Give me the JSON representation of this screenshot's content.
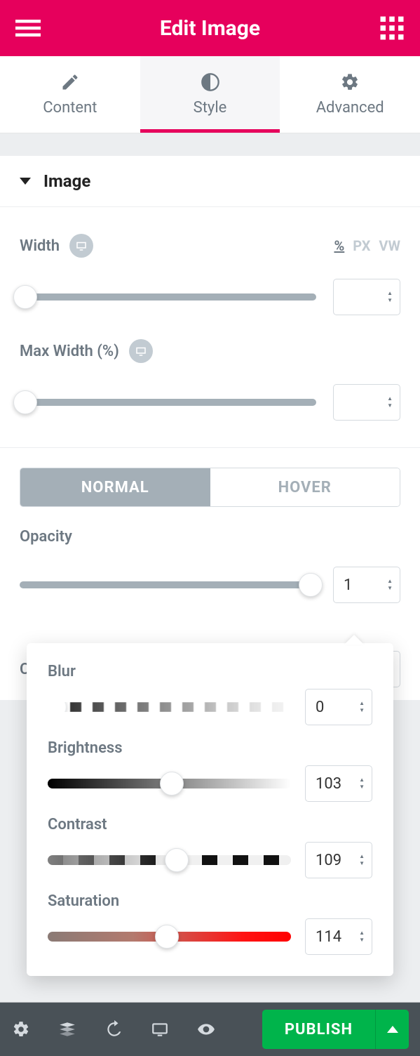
{
  "header": {
    "title": "Edit Image"
  },
  "tabs": {
    "content": "Content",
    "style": "Style",
    "advanced": "Advanced",
    "active": "style"
  },
  "section": {
    "title": "Image"
  },
  "width": {
    "label": "Width",
    "units": [
      "%",
      "PX",
      "VW"
    ],
    "selected_unit": "%",
    "value": ""
  },
  "max_width": {
    "label": "Max Width (%)",
    "value": ""
  },
  "state_toggle": {
    "normal": "NORMAL",
    "hover": "HOVER",
    "active": "normal"
  },
  "opacity": {
    "label": "Opacity",
    "value": "1"
  },
  "css_filters": {
    "label": "CSS Filters"
  },
  "filters": {
    "blur": {
      "label": "Blur",
      "value": "0"
    },
    "brightness": {
      "label": "Brightness",
      "value": "103"
    },
    "contrast": {
      "label": "Contrast",
      "value": "109"
    },
    "saturation": {
      "label": "Saturation",
      "value": "114"
    }
  },
  "footer": {
    "publish": "PUBLISH"
  }
}
